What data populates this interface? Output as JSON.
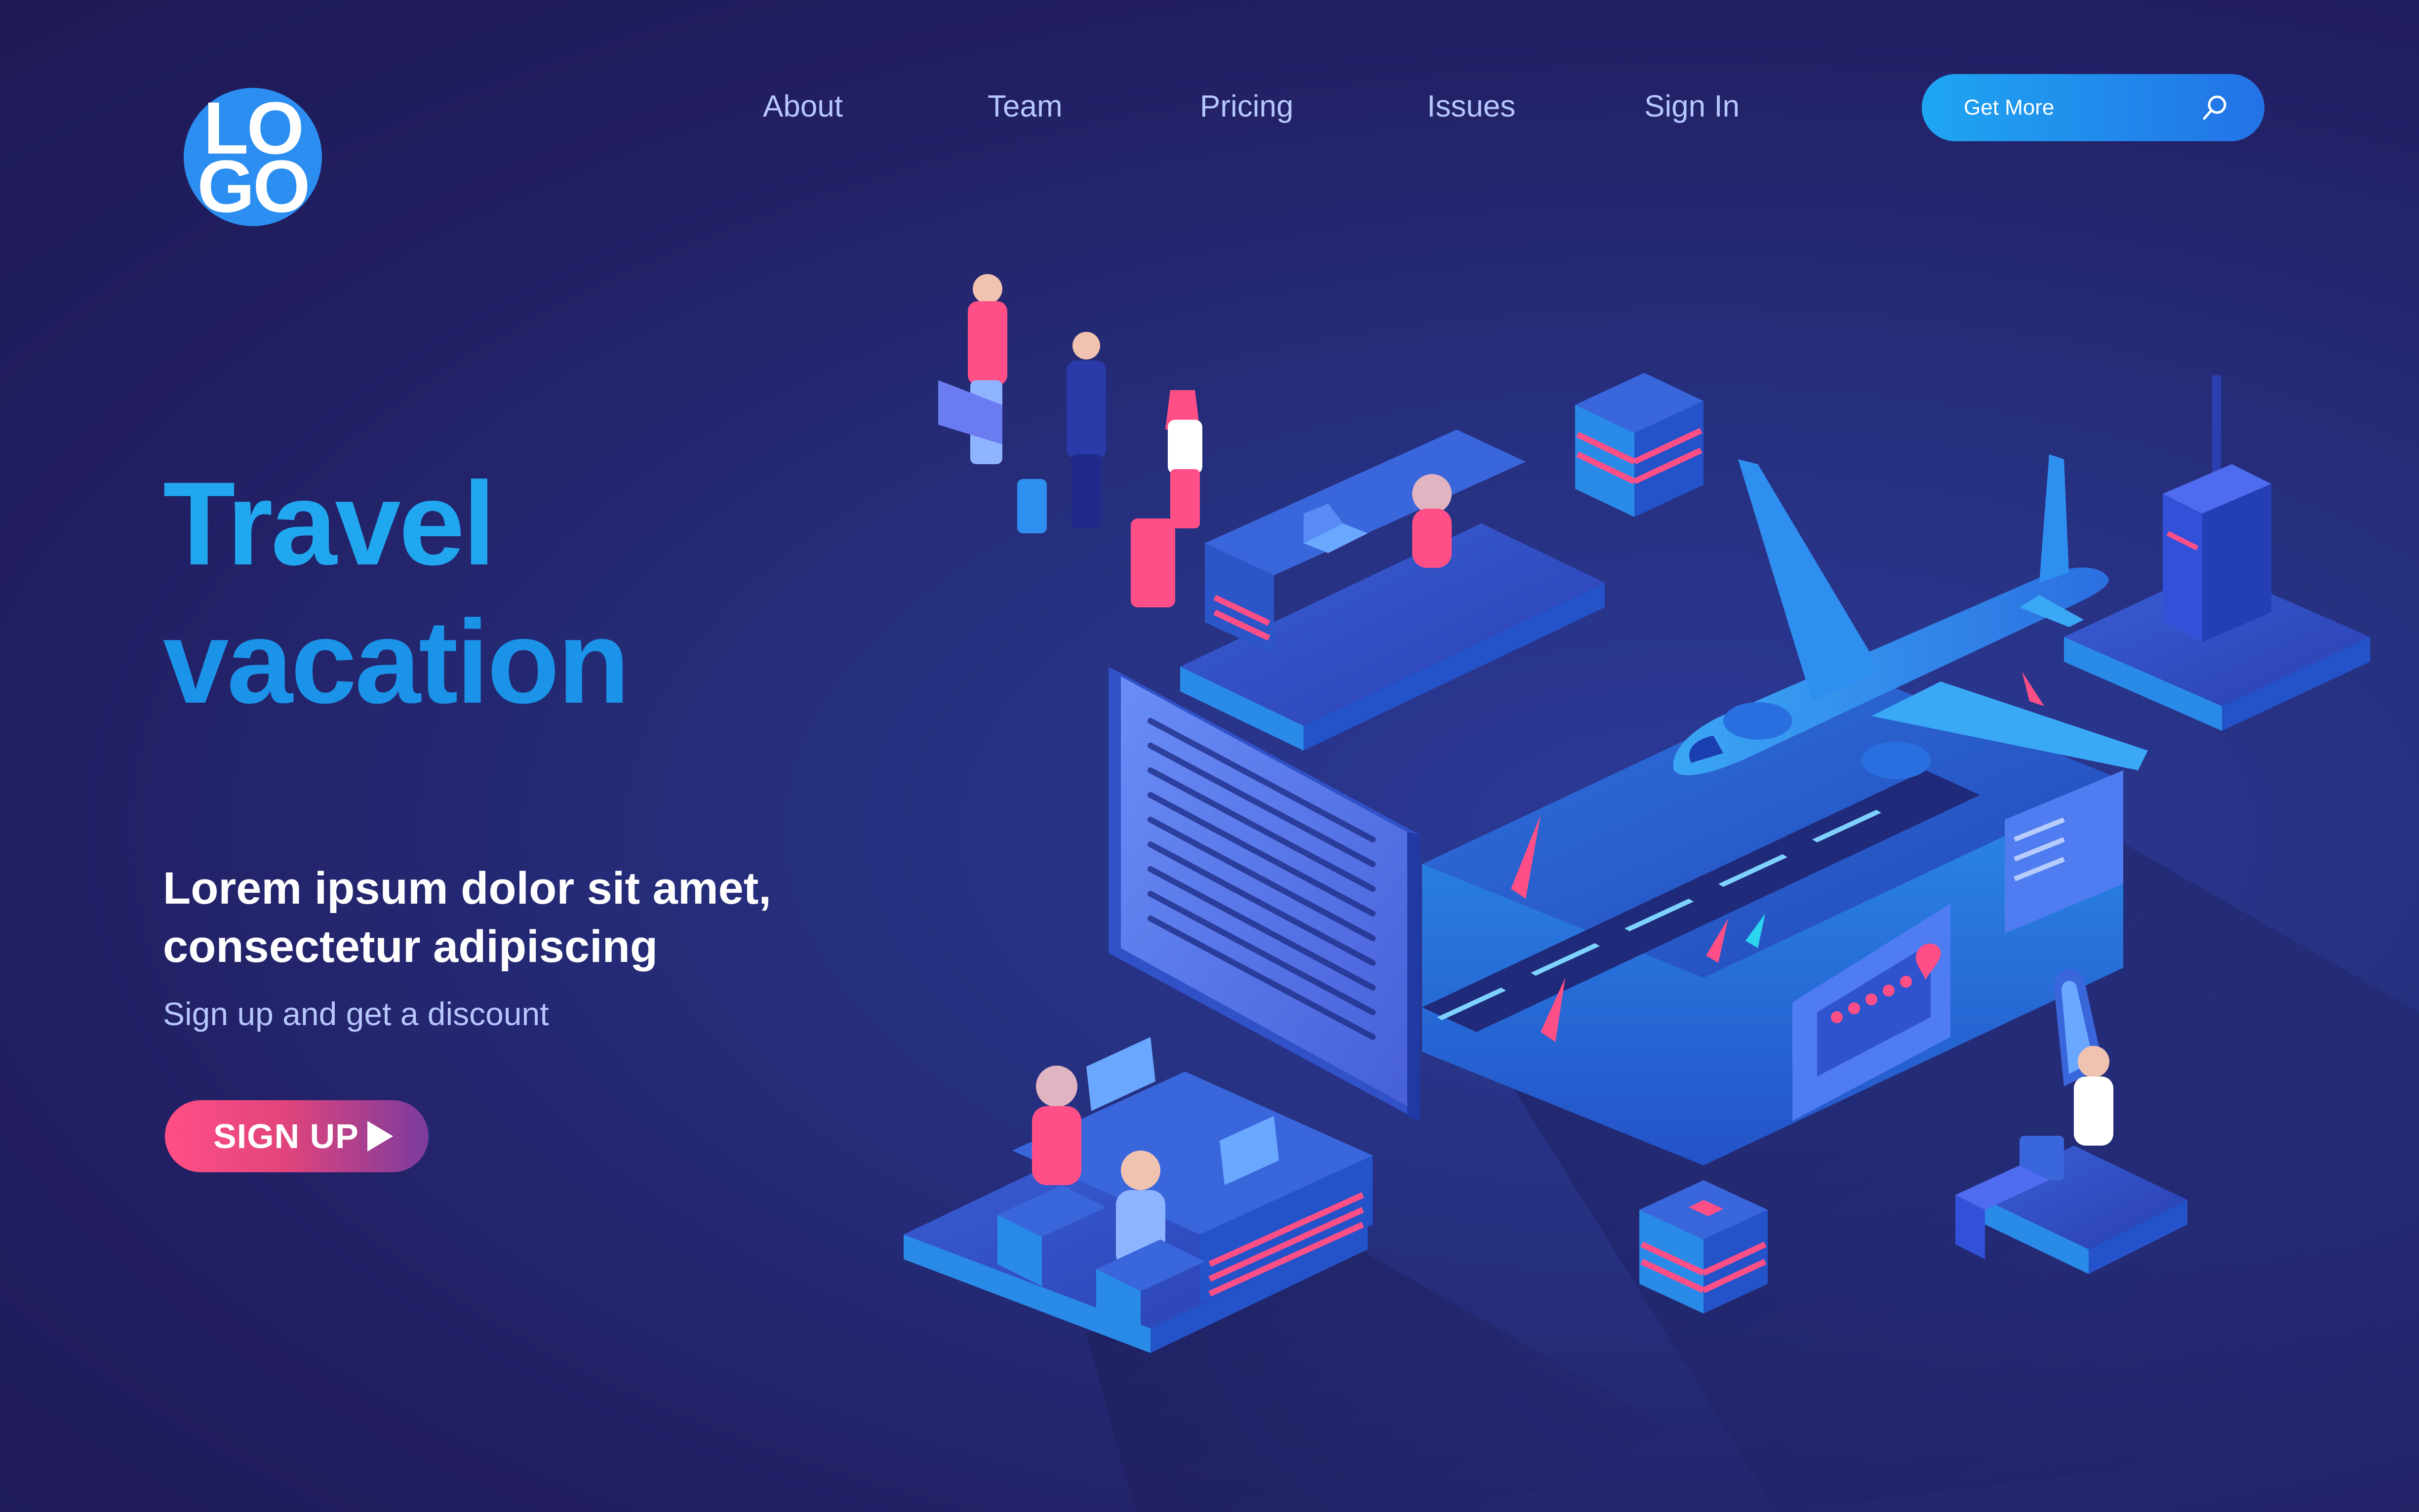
{
  "logo": {
    "text_line1": "LO",
    "text_line2": "GO"
  },
  "nav": {
    "items": [
      {
        "label": "About"
      },
      {
        "label": "Team"
      },
      {
        "label": "Pricing"
      },
      {
        "label": "Issues"
      },
      {
        "label": "Sign In"
      }
    ]
  },
  "search": {
    "placeholder": "Get More",
    "icon": "search-icon"
  },
  "hero": {
    "title_line1": "Travel",
    "title_line2": "vacation",
    "subtitle_line1": "Lorem ipsum dolor sit amet,",
    "subtitle_line2": "consectetur adipiscing",
    "note": "Sign up and get a discount",
    "cta_label": "SIGN UP",
    "cta_icon": "play-arrow-icon"
  },
  "colors": {
    "background": "#221f63",
    "accent_blue": "#21a7f0",
    "accent_pink": "#ff4f86",
    "nav_text": "#b6c7ff"
  }
}
